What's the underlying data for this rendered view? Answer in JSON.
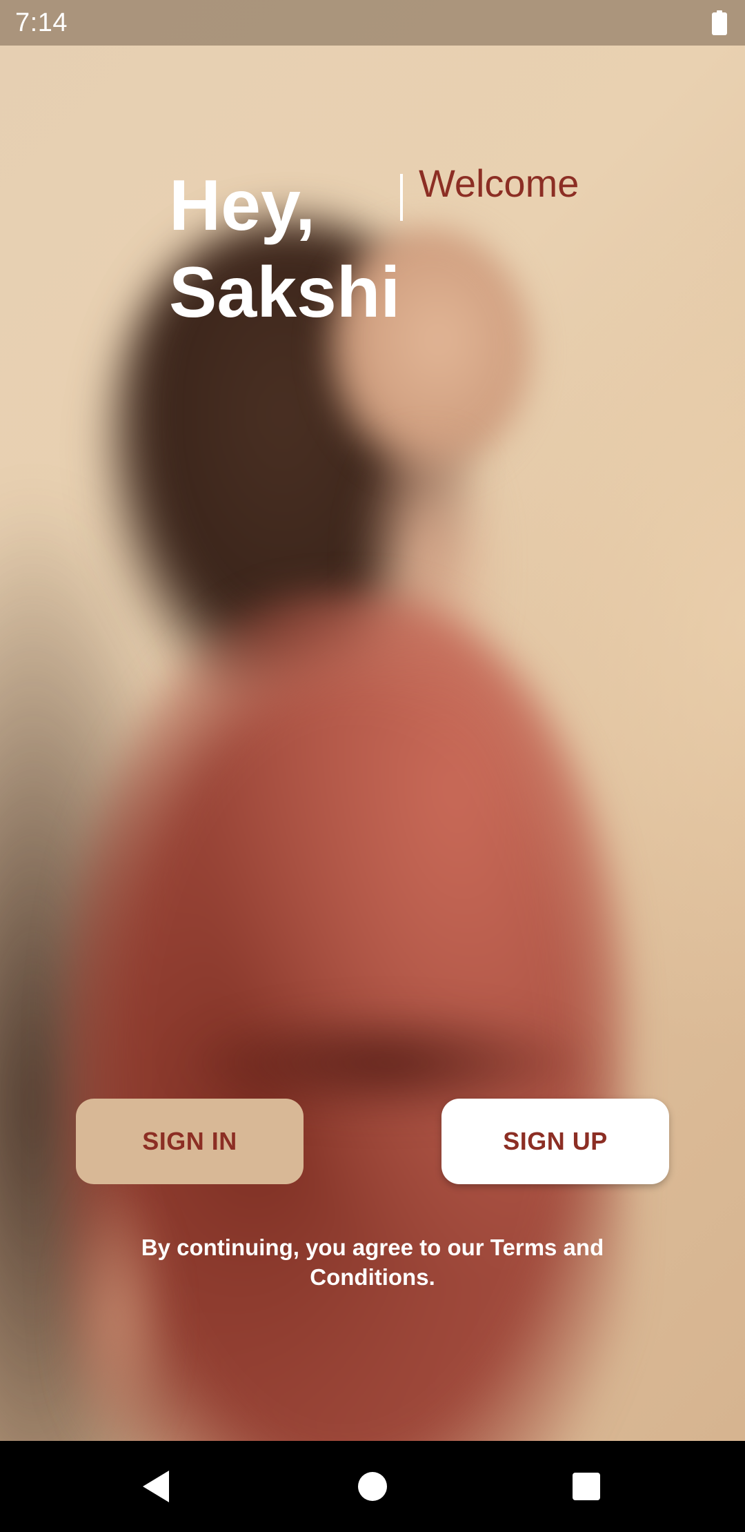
{
  "status_bar": {
    "time": "7:14",
    "battery_icon": "battery-full-icon"
  },
  "greeting": {
    "line1": "Hey,",
    "line2": "Sakshi",
    "welcome": "Welcome"
  },
  "actions": {
    "sign_in_label": "SIGN IN",
    "sign_up_label": "SIGN UP"
  },
  "terms_text": "By continuing, you agree to our Terms and Conditions.",
  "nav_bar": {
    "back_icon": "back-triangle-icon",
    "home_icon": "home-circle-icon",
    "recents_icon": "recents-square-icon"
  },
  "colors": {
    "accent": "#8c2e24",
    "sign_in_bg": "#d8b896",
    "sign_up_bg": "#ffffff"
  }
}
